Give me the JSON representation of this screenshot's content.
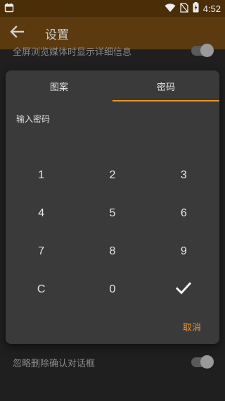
{
  "status_bar": {
    "time": "4:52",
    "icons": [
      "calendar-icon",
      "wifi-icon",
      "no-sim-icon",
      "battery-charging-icon"
    ]
  },
  "app_bar": {
    "title": "设置",
    "back_icon": "arrow-back-icon"
  },
  "settings": {
    "row_top_label": "全屏浏览媒体时显示详细信息",
    "row_bottom_label": "忽略删除确认对话框"
  },
  "dialog": {
    "tabs": [
      {
        "label": "图案",
        "active": false
      },
      {
        "label": "密码",
        "active": true
      }
    ],
    "prompt": "输入密码",
    "keys": [
      [
        "1",
        "2",
        "3"
      ],
      [
        "4",
        "5",
        "6"
      ],
      [
        "7",
        "8",
        "9"
      ],
      [
        "C",
        "0",
        "check-icon"
      ]
    ],
    "cancel_label": "取消"
  },
  "colors": {
    "accent": "#e8962a",
    "app_bar": "#5a3a0e",
    "status_bar": "#4a2e08",
    "dialog_bg": "#3a3a3a",
    "page_bg": "#1f1f1f"
  }
}
